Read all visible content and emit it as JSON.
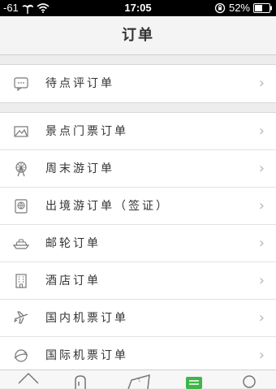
{
  "status_bar": {
    "signal": "-61",
    "time": "17:05",
    "battery": "52%",
    "icons": [
      "palm-tree-icon",
      "wifi-icon",
      "rotation-lock-icon",
      "battery-icon"
    ]
  },
  "nav": {
    "title": "订单"
  },
  "groups": [
    {
      "items": [
        {
          "label": "待点评订单",
          "icon": "comment-icon"
        }
      ]
    },
    {
      "items": [
        {
          "label": "景点门票订单",
          "icon": "picture-icon"
        },
        {
          "label": "周末游订单",
          "icon": "ferris-wheel-icon"
        },
        {
          "label": "出境游订单（签证）",
          "icon": "passport-icon"
        },
        {
          "label": "邮轮订单",
          "icon": "cruise-ship-icon"
        },
        {
          "label": "酒店订单",
          "icon": "hotel-icon"
        },
        {
          "label": "国内机票订单",
          "icon": "airplane-icon"
        },
        {
          "label": "国际机票订单",
          "icon": "globe-plane-icon"
        }
      ]
    }
  ],
  "chevron": "›",
  "tabbar": {
    "icons": [
      "home-icon",
      "bag-icon",
      "ticket-icon",
      "orders-icon",
      "profile-icon"
    ],
    "active_color": "#3fb54a"
  }
}
